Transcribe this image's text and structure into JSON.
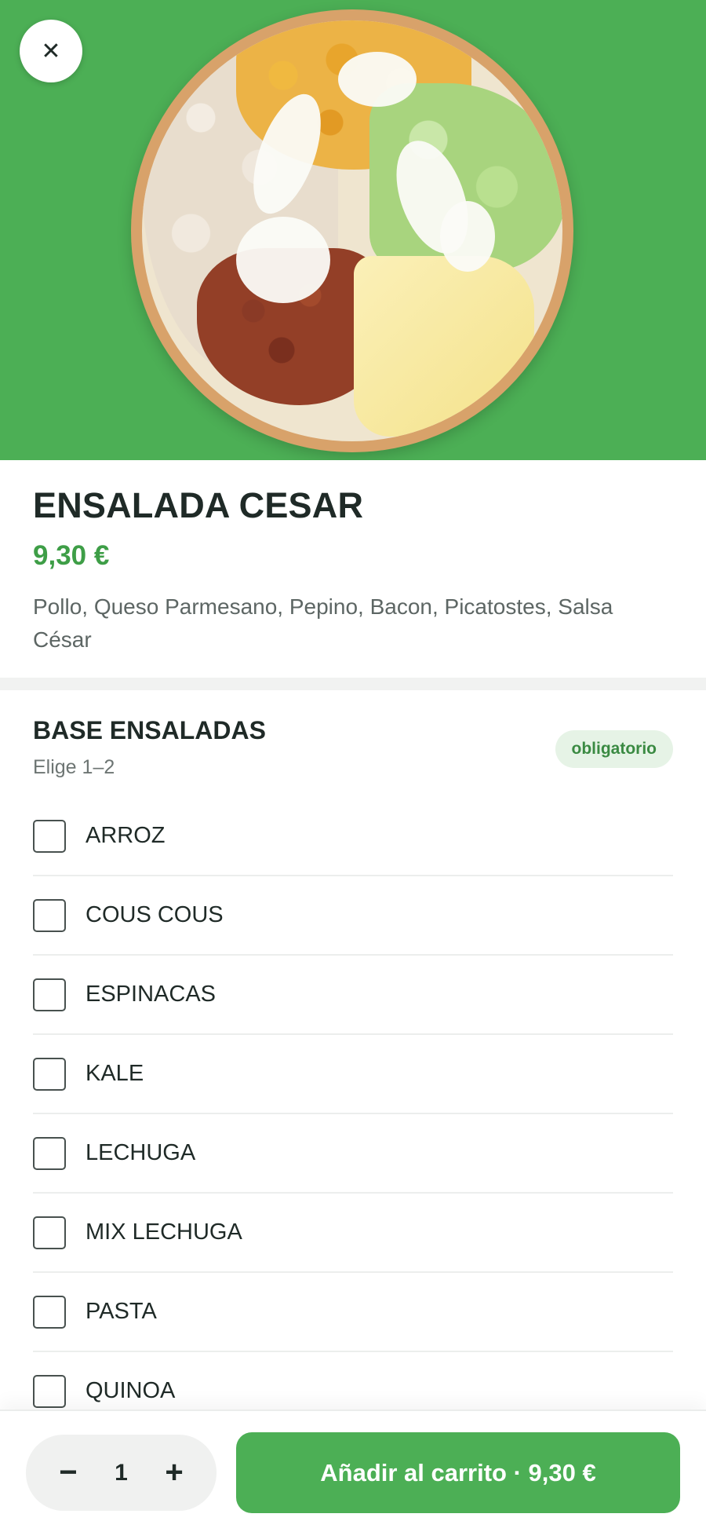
{
  "header": {
    "close_icon": "close-icon",
    "close_glyph": "✕",
    "hero_background": "#4caf55"
  },
  "product": {
    "name": "ENSALADA CESAR",
    "price": "9,30 €",
    "description": "Pollo, Queso Parmesano, Pepino, Bacon, Picatostes, Salsa César"
  },
  "group": {
    "title": "BASE ENSALADAS",
    "subtitle": "Elige 1–2",
    "badge": "obligatorio",
    "options": [
      {
        "label": "ARROZ",
        "checked": false
      },
      {
        "label": "COUS COUS",
        "checked": false
      },
      {
        "label": "ESPINACAS",
        "checked": false
      },
      {
        "label": "KALE",
        "checked": false
      },
      {
        "label": "LECHUGA",
        "checked": false
      },
      {
        "label": "MIX LECHUGA",
        "checked": false
      },
      {
        "label": "PASTA",
        "checked": false
      },
      {
        "label": "QUINOA",
        "checked": false
      }
    ]
  },
  "footer": {
    "decrement": "−",
    "quantity": "1",
    "increment": "+",
    "add_button": "Añadir al carrito · 9,30 €"
  },
  "colors": {
    "accent": "#4caf55",
    "price": "#3e9e47",
    "badge_bg": "#e6f3e6"
  }
}
